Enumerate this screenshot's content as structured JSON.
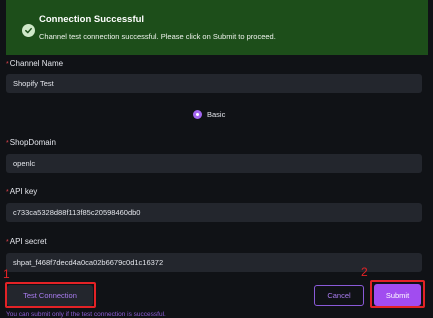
{
  "banner": {
    "title": "Connection Successful",
    "message": "Channel test connection successful. Please click on Submit to proceed.",
    "icon": "check-circle-icon",
    "color": "#1d4e1a"
  },
  "form": {
    "required_marker": "*",
    "channel_name": {
      "label": "Channel Name",
      "value": "Shopify Test"
    },
    "auth_type": {
      "selected": "Basic"
    },
    "shop_domain": {
      "label": "ShopDomain",
      "value": "openlc"
    },
    "api_key": {
      "label": "API key",
      "value": "c733ca5328d88f113f85c20598460db0"
    },
    "api_secret": {
      "label": "API secret",
      "value": "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"
    }
  },
  "actions": {
    "test_connection": "Test Connection",
    "cancel": "Cancel",
    "submit": "Submit",
    "accent": "#a14cf0"
  },
  "annotations": {
    "marker_1": "1",
    "marker_2": "2",
    "color": "#e32226"
  },
  "footnote": "You can submit only if the test connection is successful."
}
